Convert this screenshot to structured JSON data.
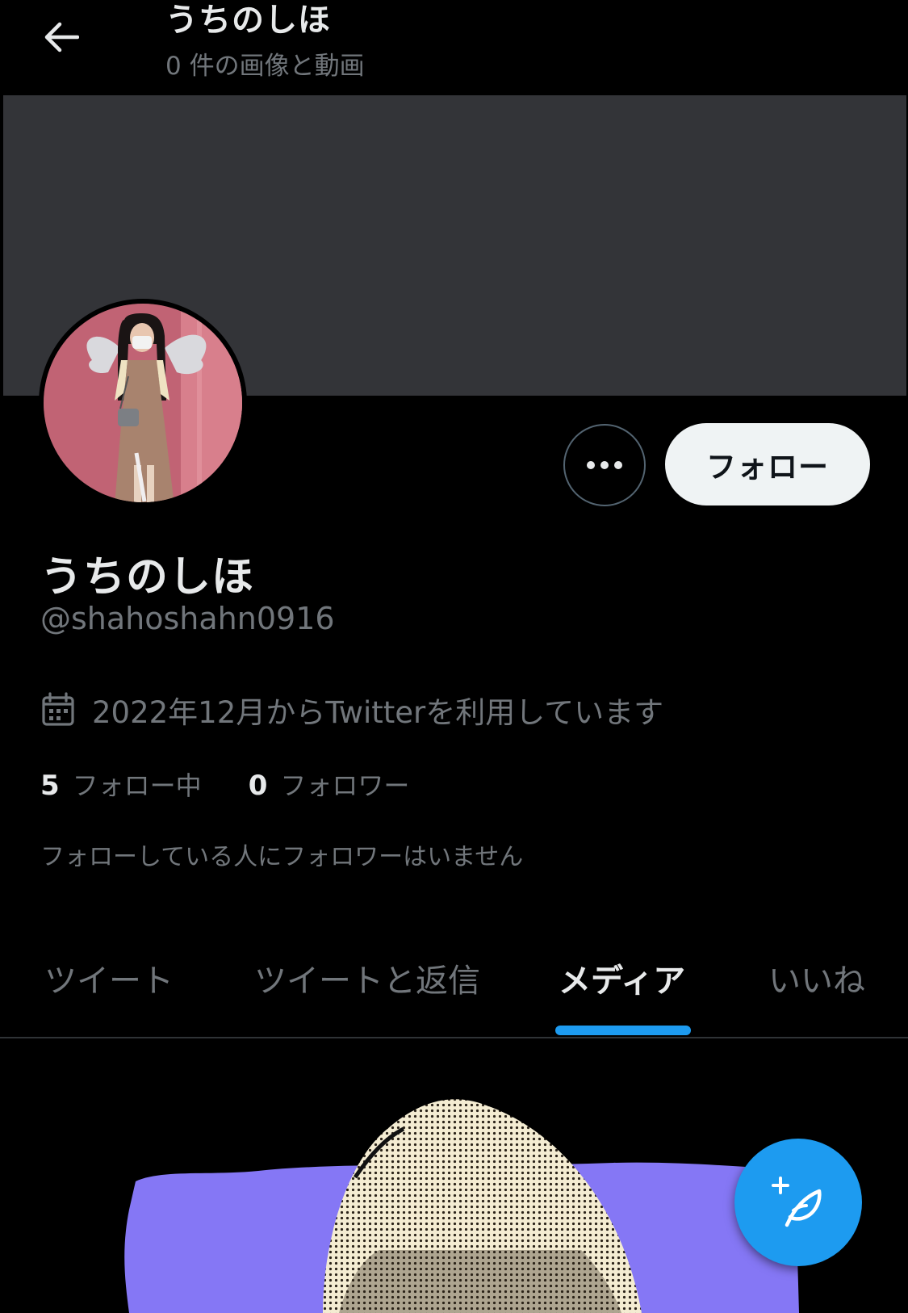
{
  "header": {
    "title": "うちのしほ",
    "subtitle": "0 件の画像と動画",
    "back_icon": "arrow-left-icon"
  },
  "profile": {
    "display_name": "うちのしほ",
    "handle": "@shahoshahn0916",
    "joined": "2022年12月からTwitterを利用しています",
    "following_count": "5",
    "following_label": "フォロー中",
    "followers_count": "0",
    "followers_label": "フォロワー",
    "followers_you_know": "フォローしている人にフォロワーはいません"
  },
  "actions": {
    "more_icon": "more-horizontal-icon",
    "follow_label": "フォロー"
  },
  "tabs": [
    {
      "label": "ツイート",
      "active": false
    },
    {
      "label": "ツイートと返信",
      "active": false
    },
    {
      "label": "メディア",
      "active": true
    },
    {
      "label": "いいね",
      "active": false
    }
  ],
  "fab": {
    "icon": "compose-tweet-icon"
  },
  "colors": {
    "background": "#000000",
    "banner": "#333438",
    "accent": "#1d9bf0",
    "text_primary": "#e7e9ea",
    "text_secondary": "#71767b",
    "media_purple": "#8577f5"
  }
}
